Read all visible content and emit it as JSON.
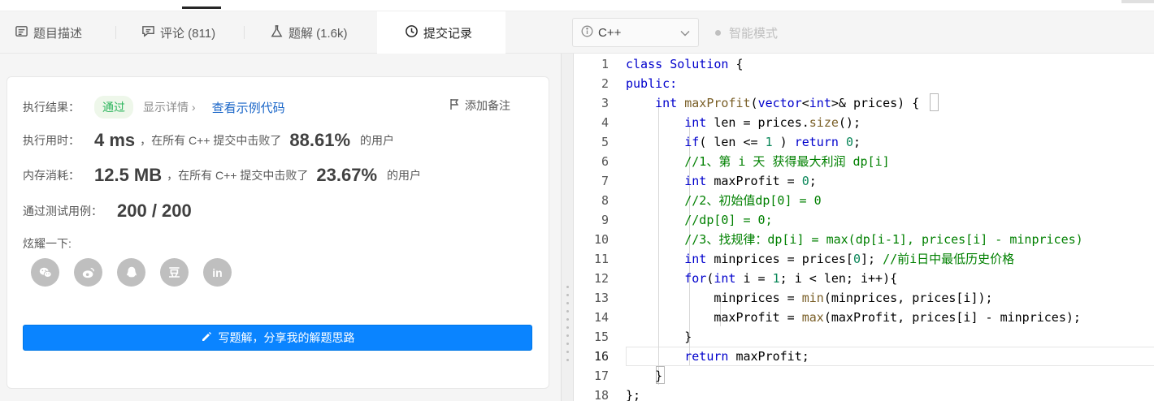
{
  "left_tabs": [
    {
      "label": "题目描述",
      "icon": "description-icon"
    },
    {
      "label": "评论 (811)",
      "icon": "comment-icon"
    },
    {
      "label": "题解 (1.6k)",
      "icon": "flask-icon"
    },
    {
      "label": "提交记录",
      "icon": "clock-icon",
      "active": true
    }
  ],
  "result": {
    "label": "执行结果：",
    "status": "通过",
    "details": "显示详情 ›",
    "sample_link": "查看示例代码",
    "note": "添加备注"
  },
  "runtime": {
    "label": "执行用时：",
    "value": "4 ms",
    "text": "，在所有 C++ 提交中击败了",
    "percent": "88.61%",
    "suffix": "的用户"
  },
  "memory": {
    "label": "内存消耗：",
    "value": "12.5 MB",
    "text": "，在所有 C++ 提交中击败了",
    "percent": "23.67%",
    "suffix": "的用户"
  },
  "tests": {
    "label": "通过测试用例：",
    "value": "200 / 200"
  },
  "share": {
    "label": "炫耀一下:",
    "icons": [
      "wechat-icon",
      "weibo-icon",
      "qq-icon",
      "douban-icon",
      "linkedin-icon"
    ],
    "douban_glyph": "豆",
    "linkedin_glyph": "in"
  },
  "write_button": "写题解，分享我的解题思路",
  "editor_toolbar": {
    "language": "C++",
    "smart_mode": "智能模式"
  },
  "code": {
    "line_numbers": [
      "1",
      "2",
      "3",
      "4",
      "5",
      "6",
      "7",
      "8",
      "9",
      "10",
      "11",
      "12",
      "13",
      "14",
      "15",
      "16",
      "17",
      "18"
    ],
    "current_line": 16,
    "lines": [
      [
        {
          "t": "class ",
          "c": "kw"
        },
        {
          "t": "Solution",
          "c": "kw"
        },
        {
          "t": " {",
          "c": ""
        }
      ],
      [
        {
          "t": "public:",
          "c": "kw"
        }
      ],
      [
        {
          "t": "    ",
          "c": ""
        },
        {
          "t": "int",
          "c": "kw"
        },
        {
          "t": " ",
          "c": ""
        },
        {
          "t": "maxProfit",
          "c": "fn"
        },
        {
          "t": "(",
          "c": ""
        },
        {
          "t": "vector",
          "c": "kw"
        },
        {
          "t": "<",
          "c": ""
        },
        {
          "t": "int",
          "c": "kw"
        },
        {
          "t": ">& prices) {",
          "c": ""
        }
      ],
      [
        {
          "t": "        ",
          "c": ""
        },
        {
          "t": "int",
          "c": "kw"
        },
        {
          "t": " len = prices.",
          "c": ""
        },
        {
          "t": "size",
          "c": "fn"
        },
        {
          "t": "();",
          "c": ""
        }
      ],
      [
        {
          "t": "        ",
          "c": ""
        },
        {
          "t": "if",
          "c": "kw"
        },
        {
          "t": "( len <= ",
          "c": ""
        },
        {
          "t": "1",
          "c": "num"
        },
        {
          "t": " ) ",
          "c": ""
        },
        {
          "t": "return",
          "c": "kw"
        },
        {
          "t": " ",
          "c": ""
        },
        {
          "t": "0",
          "c": "num"
        },
        {
          "t": ";",
          "c": ""
        }
      ],
      [
        {
          "t": "        ",
          "c": ""
        },
        {
          "t": "//1、第 i 天 获得最大利润 dp[i]",
          "c": "cm"
        }
      ],
      [
        {
          "t": "        ",
          "c": ""
        },
        {
          "t": "int",
          "c": "kw"
        },
        {
          "t": " maxProfit = ",
          "c": ""
        },
        {
          "t": "0",
          "c": "num"
        },
        {
          "t": ";",
          "c": ""
        }
      ],
      [
        {
          "t": "        ",
          "c": ""
        },
        {
          "t": "//2、初始值dp[0] = 0",
          "c": "cm"
        }
      ],
      [
        {
          "t": "        ",
          "c": ""
        },
        {
          "t": "//dp[0] = 0;",
          "c": "cm"
        }
      ],
      [
        {
          "t": "        ",
          "c": ""
        },
        {
          "t": "//3、找规律：dp[i] = max(dp[i-1], prices[i] - minprices)",
          "c": "cm"
        }
      ],
      [
        {
          "t": "        ",
          "c": ""
        },
        {
          "t": "int",
          "c": "kw"
        },
        {
          "t": " minprices = prices[",
          "c": ""
        },
        {
          "t": "0",
          "c": "num"
        },
        {
          "t": "]; ",
          "c": ""
        },
        {
          "t": "//前i日中最低历史价格",
          "c": "cm"
        }
      ],
      [
        {
          "t": "        ",
          "c": ""
        },
        {
          "t": "for",
          "c": "kw"
        },
        {
          "t": "(",
          "c": ""
        },
        {
          "t": "int",
          "c": "kw"
        },
        {
          "t": " i = ",
          "c": ""
        },
        {
          "t": "1",
          "c": "num"
        },
        {
          "t": "; i < len; i++){",
          "c": ""
        }
      ],
      [
        {
          "t": "            minprices = ",
          "c": ""
        },
        {
          "t": "min",
          "c": "fn"
        },
        {
          "t": "(minprices, prices[i]);",
          "c": ""
        }
      ],
      [
        {
          "t": "            maxProfit = ",
          "c": ""
        },
        {
          "t": "max",
          "c": "fn"
        },
        {
          "t": "(maxProfit, prices[i] - minprices);",
          "c": ""
        }
      ],
      [
        {
          "t": "        }",
          "c": ""
        }
      ],
      [
        {
          "t": "        ",
          "c": ""
        },
        {
          "t": "return",
          "c": "kw"
        },
        {
          "t": " maxProfit;",
          "c": ""
        }
      ],
      [
        {
          "t": "    }",
          "c": ""
        }
      ],
      [
        {
          "t": "};",
          "c": ""
        }
      ]
    ]
  },
  "colors": {
    "accent": "#0a84ff",
    "success": "#2db55d",
    "link": "#1a66c8",
    "keyword": "#0000cc",
    "comment": "#008000",
    "number": "#098658"
  }
}
